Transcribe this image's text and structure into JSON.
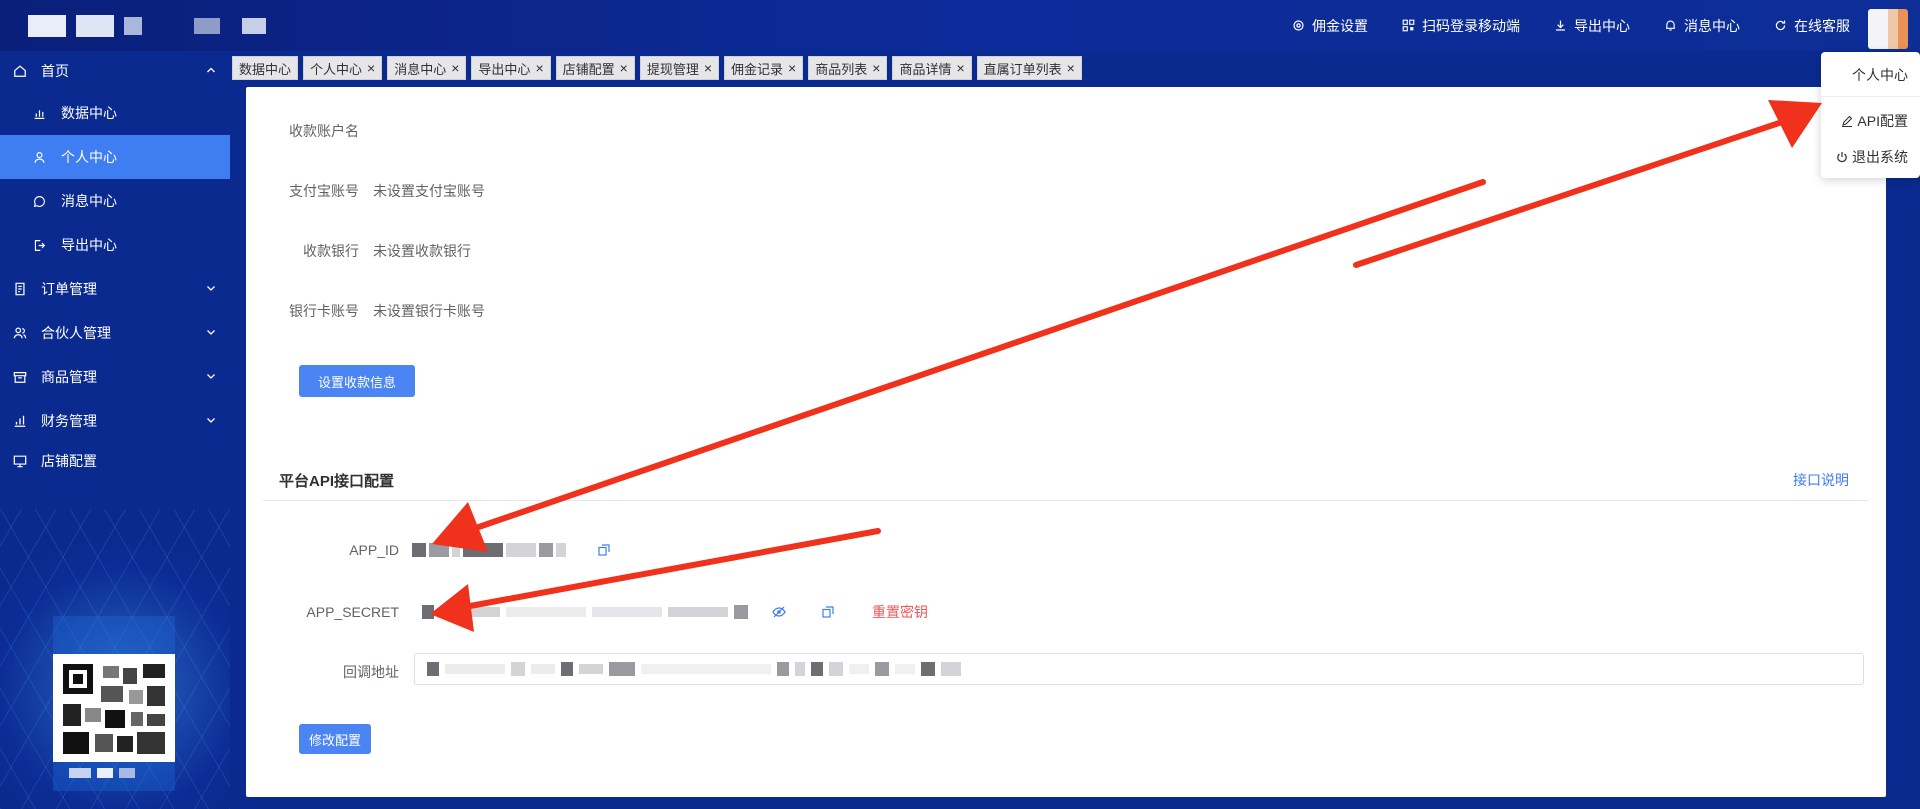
{
  "topbar": {
    "nav": [
      {
        "label": "佣金设置",
        "icon": "gear-icon"
      },
      {
        "label": "扫码登录移动端",
        "icon": "qrcode-icon"
      },
      {
        "label": "导出中心",
        "icon": "download-icon"
      },
      {
        "label": "消息中心",
        "icon": "bell-icon"
      },
      {
        "label": "在线客服",
        "icon": "refresh-icon"
      }
    ]
  },
  "sidebar": {
    "home": {
      "label": "首页",
      "icon": "home-icon"
    },
    "sub": [
      {
        "label": "数据中心",
        "icon": "chart-icon"
      },
      {
        "label": "个人中心",
        "icon": "user-icon"
      },
      {
        "label": "消息中心",
        "icon": "message-icon"
      },
      {
        "label": "导出中心",
        "icon": "export-icon"
      }
    ],
    "groups": [
      {
        "label": "订单管理",
        "icon": "document-icon"
      },
      {
        "label": "合伙人管理",
        "icon": "users-icon"
      },
      {
        "label": "商品管理",
        "icon": "box-icon"
      },
      {
        "label": "财务管理",
        "icon": "finance-chart-icon"
      },
      {
        "label": "店铺配置",
        "icon": "monitor-icon"
      }
    ]
  },
  "tabs": [
    "数据中心",
    "个人中心",
    "消息中心",
    "导出中心",
    "店铺配置",
    "提现管理",
    "佣金记录",
    "商品列表",
    "商品详情",
    "直属订单列表"
  ],
  "payment": {
    "account_name_label": "收款账户名",
    "alipay_label": "支付宝账号",
    "alipay_value": "未设置支付宝账号",
    "bank_label": "收款银行",
    "bank_value": "未设置收款银行",
    "card_label": "银行卡账号",
    "card_value": "未设置银行卡账号",
    "set_button": "设置收款信息"
  },
  "api": {
    "title": "平台API接口配置",
    "doc_link": "接口说明",
    "app_id_label": "APP_ID",
    "app_secret_label": "APP_SECRET",
    "reset_secret": "重置密钥",
    "callback_label": "回调地址",
    "edit_button": "修改配置"
  },
  "dropdown": {
    "personal": "个人中心",
    "api_config": "API配置",
    "logout": "退出系统"
  },
  "colors": {
    "primary": "#3f7df2",
    "sidebar": "#0b2a8f",
    "danger": "#f05656",
    "annotation": "#f0311c"
  }
}
